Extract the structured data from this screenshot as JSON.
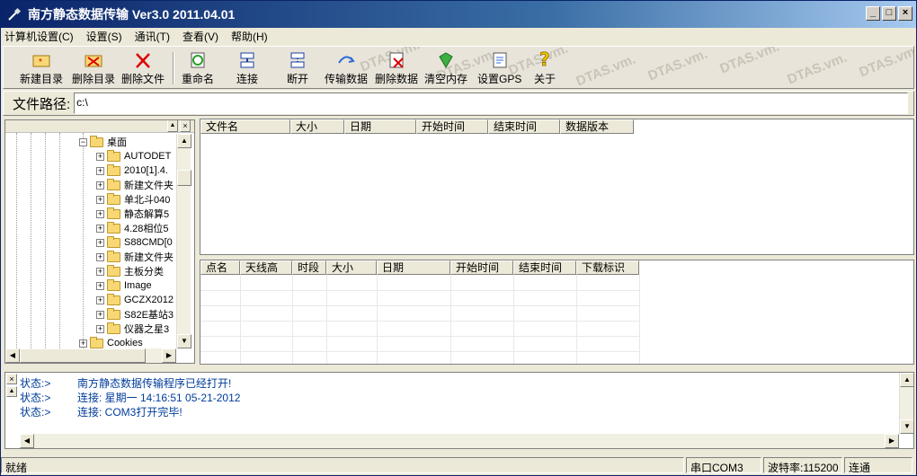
{
  "window": {
    "title": "南方静态数据传输 Ver3.0 2011.04.01",
    "min": "_",
    "max": "□",
    "close": "×"
  },
  "menu": [
    "计算机设置(C)",
    "设置(S)",
    "通讯(T)",
    "查看(V)",
    "帮助(H)"
  ],
  "toolbar": {
    "buttons": [
      {
        "label": "新建目录",
        "icon": "new-folder-icon"
      },
      {
        "label": "删除目录",
        "icon": "delete-folder-icon"
      },
      {
        "label": "删除文件",
        "icon": "delete-file-icon"
      },
      {
        "label": "重命名",
        "icon": "rename-icon"
      },
      {
        "label": "连接",
        "icon": "connect-icon"
      },
      {
        "label": "断开",
        "icon": "disconnect-icon"
      },
      {
        "label": "传输数据",
        "icon": "transfer-icon"
      },
      {
        "label": "删除数据",
        "icon": "delete-data-icon"
      },
      {
        "label": "清空内存",
        "icon": "clear-memory-icon"
      },
      {
        "label": "设置GPS",
        "icon": "gps-settings-icon"
      },
      {
        "label": "关于",
        "icon": "about-icon"
      }
    ],
    "watermark": "DTAS.vm."
  },
  "path": {
    "label": "文件路径:",
    "value": "c:\\"
  },
  "tree": {
    "root": "桌面",
    "items": [
      "AUTODET",
      "2010[1].4.",
      "新建文件夹",
      "单北斗040",
      "静态解算5",
      "4.28相位5",
      "S88CMD[0",
      "新建文件夹",
      "主板分类",
      "Image",
      "GCZX2012",
      "S82E基站3",
      "仪器之星3"
    ],
    "sibling": "Cookies"
  },
  "files_table": {
    "columns": [
      "文件名",
      "大小",
      "日期",
      "开始时间",
      "结束时间",
      "数据版本"
    ]
  },
  "points_table": {
    "columns": [
      "点名",
      "天线高",
      "时段",
      "大小",
      "日期",
      "开始时间",
      "结束时间",
      "下载标识"
    ]
  },
  "log": [
    {
      "key": "状态:>",
      "msg": "南方静态数据传输程序已经打开!"
    },
    {
      "key": "状态:>",
      "msg": "连接: 星期一 14:16:51 05-21-2012"
    },
    {
      "key": "状态:>",
      "msg": "连接: COM3打开完毕!"
    }
  ],
  "status": {
    "left": "就绪",
    "port": "串口COM3",
    "baud": "波特率:115200",
    "state": "连通"
  }
}
